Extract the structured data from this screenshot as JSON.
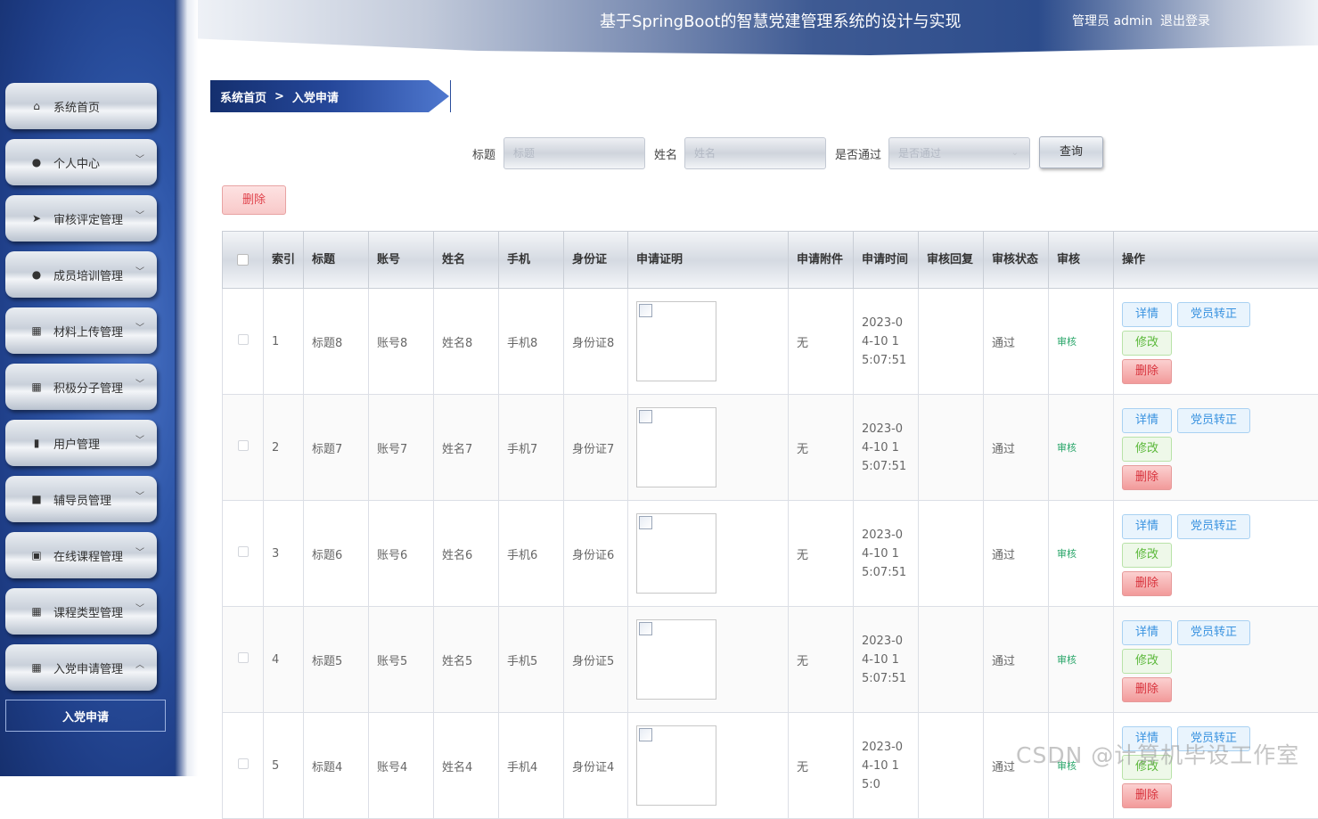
{
  "app": {
    "title": "基于SpringBoot的智慧党建管理系统的设计与实现",
    "user": "管理员 admin",
    "logout": "退出登录"
  },
  "sidebar": {
    "items": [
      {
        "label": "系统首页",
        "icon": "home-icon",
        "glyph": "⌂",
        "expanded": null
      },
      {
        "label": "个人中心",
        "icon": "user-icon",
        "glyph": "●",
        "expanded": false
      },
      {
        "label": "审核评定管理",
        "icon": "send-icon",
        "glyph": "➤",
        "expanded": false
      },
      {
        "label": "成员培训管理",
        "icon": "bulb-icon",
        "glyph": "●",
        "expanded": false
      },
      {
        "label": "材料上传管理",
        "icon": "grid-icon",
        "glyph": "▦",
        "expanded": false
      },
      {
        "label": "积极分子管理",
        "icon": "grid-icon",
        "glyph": "▦",
        "expanded": false
      },
      {
        "label": "用户管理",
        "icon": "bar-chart-icon",
        "glyph": "▮",
        "expanded": false
      },
      {
        "label": "辅导员管理",
        "icon": "video-icon",
        "glyph": "■",
        "expanded": false
      },
      {
        "label": "在线课程管理",
        "icon": "clipboard-icon",
        "glyph": "▣",
        "expanded": false
      },
      {
        "label": "课程类型管理",
        "icon": "grid-icon",
        "glyph": "▦",
        "expanded": false
      },
      {
        "label": "入党申请管理",
        "icon": "grid-icon",
        "glyph": "▦",
        "expanded": true
      }
    ],
    "sub_item": "入党申请"
  },
  "breadcrumb": {
    "home": "系统首页",
    "sep": ">",
    "current": "入党申请"
  },
  "filters": {
    "title_label": "标题",
    "title_placeholder": "标题",
    "name_label": "姓名",
    "name_placeholder": "姓名",
    "pass_label": "是否通过",
    "pass_placeholder": "是否通过",
    "query": "查询"
  },
  "delete_label": "删除",
  "table": {
    "headers": {
      "index": "索引",
      "title": "标题",
      "account": "账号",
      "name": "姓名",
      "phone": "手机",
      "idcard": "身份证",
      "proof": "申请证明",
      "attach": "申请附件",
      "time": "申请时间",
      "reply": "审核回复",
      "status": "审核状态",
      "audit": "审核",
      "ops": "操作"
    },
    "rows": [
      {
        "index": "1",
        "title": "标题8",
        "account": "账号8",
        "name": "姓名8",
        "phone": "手机8",
        "idcard": "身份证8",
        "attach": "无",
        "time": "2023-04-10 15:07:51",
        "reply": "",
        "status": "通过",
        "audit": "审核"
      },
      {
        "index": "2",
        "title": "标题7",
        "account": "账号7",
        "name": "姓名7",
        "phone": "手机7",
        "idcard": "身份证7",
        "attach": "无",
        "time": "2023-04-10 15:07:51",
        "reply": "",
        "status": "通过",
        "audit": "审核"
      },
      {
        "index": "3",
        "title": "标题6",
        "account": "账号6",
        "name": "姓名6",
        "phone": "手机6",
        "idcard": "身份证6",
        "attach": "无",
        "time": "2023-04-10 15:07:51",
        "reply": "",
        "status": "通过",
        "audit": "审核"
      },
      {
        "index": "4",
        "title": "标题5",
        "account": "账号5",
        "name": "姓名5",
        "phone": "手机5",
        "idcard": "身份证5",
        "attach": "无",
        "time": "2023-04-10 15:07:51",
        "reply": "",
        "status": "通过",
        "audit": "审核"
      },
      {
        "index": "5",
        "title": "标题4",
        "account": "账号4",
        "name": "姓名4",
        "phone": "手机4",
        "idcard": "身份证4",
        "attach": "无",
        "time": "2023-04-10 15:0",
        "reply": "",
        "status": "通过",
        "audit": "审核"
      }
    ],
    "ops": {
      "detail": "详情",
      "transfer": "党员转正",
      "edit": "修改",
      "delete": "删除"
    }
  },
  "watermark": "CSDN @计算机毕设工作室"
}
